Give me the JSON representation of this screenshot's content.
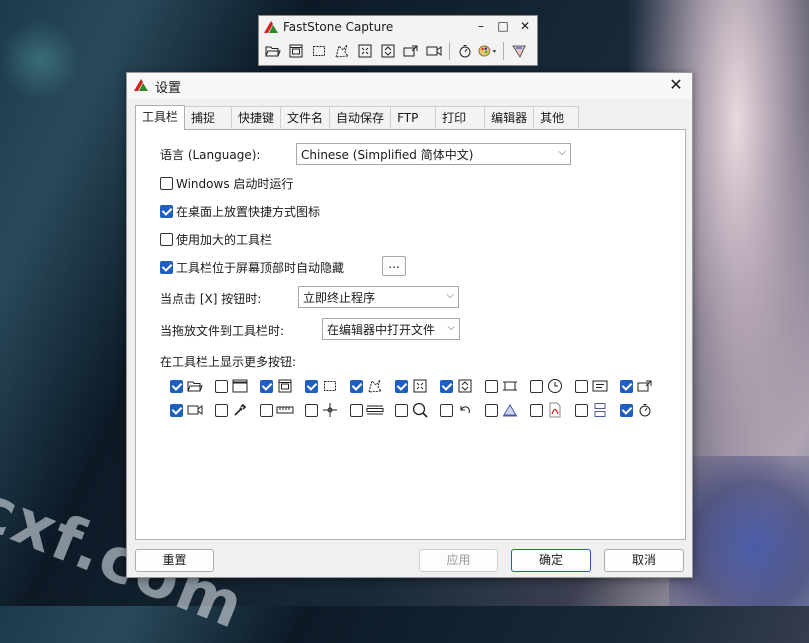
{
  "watermark": "cxf.com",
  "capture_toolbar": {
    "title": "FastStone Capture",
    "minimize": "–",
    "restore": "□",
    "close": "✕",
    "tools": [
      "open-folder-icon",
      "capture-window-icon",
      "capture-object-icon",
      "capture-rect-icon",
      "capture-freehand-icon",
      "capture-fullscreen-icon",
      "capture-scrolling-icon",
      "capture-fixed-region-icon",
      "screen-record-icon",
      "timer-icon",
      "palette-menu-icon",
      "settings-icon"
    ]
  },
  "settings": {
    "title": "设置",
    "close": "✕",
    "tabs": [
      "工具栏",
      "捕捉",
      "快捷键",
      "文件名",
      "自动保存",
      "FTP",
      "打印",
      "编辑器",
      "其他"
    ],
    "active_tab": 0,
    "language_label": "语言 (Language):",
    "language_value": "Chinese (Simplified 简体中文)",
    "opt_startup": "Windows 启动时运行",
    "opt_desktop_icon": "在桌面上放置快捷方式图标",
    "opt_large_toolbar": "使用加大的工具栏",
    "opt_autohide": "工具栏位于屏幕顶部时自动隐藏",
    "autohide_more": "...",
    "close_label": "当点击 [X] 按钮时:",
    "close_value": "立即终止程序",
    "drop_label": "当拖放文件到工具栏时:",
    "drop_value": "在编辑器中打开文件",
    "more_buttons_label": "在工具栏上显示更多按钮:",
    "more_buttons_row1": [
      {
        "icon": "open-folder-icon",
        "on": true
      },
      {
        "icon": "window-icon",
        "on": false
      },
      {
        "icon": "capture-window-icon",
        "on": true
      },
      {
        "icon": "capture-rect-icon",
        "on": true
      },
      {
        "icon": "capture-freehand-icon",
        "on": true
      },
      {
        "icon": "capture-fullscreen-icon",
        "on": true
      },
      {
        "icon": "capture-scrolling-icon",
        "on": true
      },
      {
        "icon": "capture-fixed-region-icon",
        "on": false
      },
      {
        "icon": "timer-clock-icon",
        "on": false
      },
      {
        "icon": "text-icon",
        "on": false
      },
      {
        "icon": "export-icon",
        "on": true
      }
    ],
    "more_buttons_row2": [
      {
        "icon": "screen-record-icon",
        "on": true
      },
      {
        "icon": "color-picker-icon",
        "on": false
      },
      {
        "icon": "ruler-icon",
        "on": false
      },
      {
        "icon": "crosshair-icon",
        "on": false
      },
      {
        "icon": "screen-line-icon",
        "on": false
      },
      {
        "icon": "magnifier-icon",
        "on": false
      },
      {
        "icon": "undo-icon",
        "on": false
      },
      {
        "icon": "whiteboard-icon",
        "on": false
      },
      {
        "icon": "pdf-icon",
        "on": false
      },
      {
        "icon": "compare-icon",
        "on": false
      },
      {
        "icon": "stopwatch-icon",
        "on": true
      }
    ],
    "reset": "重置",
    "apply": "应用",
    "ok": "确定",
    "cancel": "取消"
  }
}
